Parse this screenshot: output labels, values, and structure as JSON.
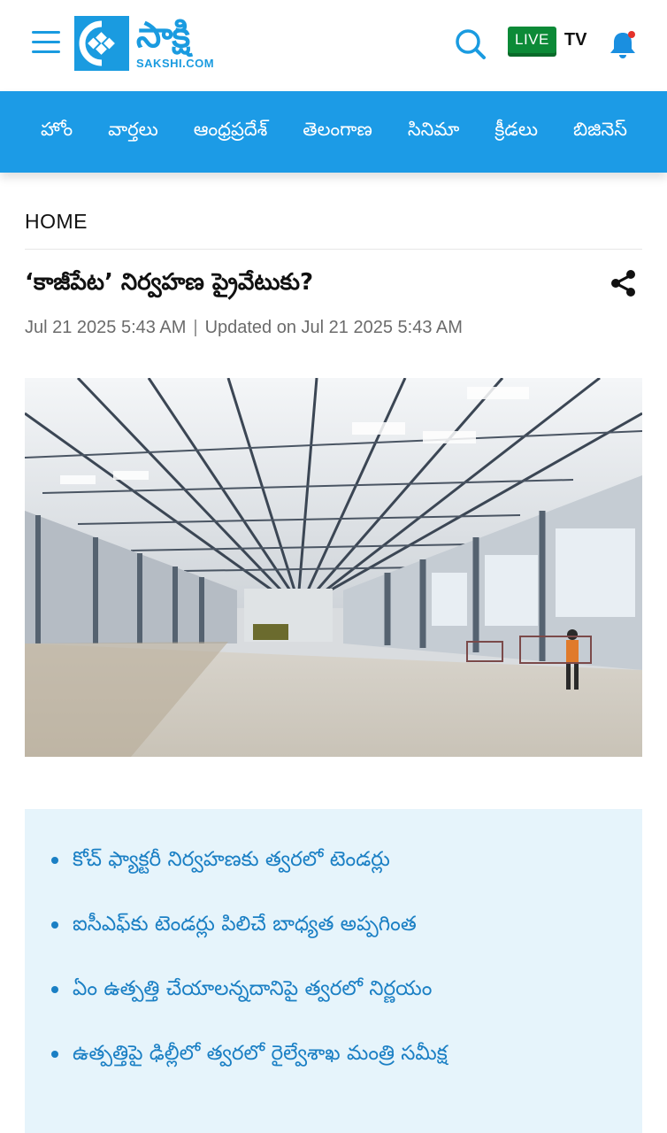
{
  "header": {
    "logo_text": "సాక్షి",
    "logo_url_text": "SAKSHI.COM",
    "live_label": "LIVE",
    "tv_label": "TV",
    "brand_color": "#1a9be0",
    "icons": [
      "menu-icon",
      "search-icon",
      "bell-icon"
    ]
  },
  "nav": {
    "items": [
      {
        "label": "హోం"
      },
      {
        "label": "వార్తలు"
      },
      {
        "label": "ఆంధ్రప్రదేశ్"
      },
      {
        "label": "తెలంగాణ"
      },
      {
        "label": "సినిమా"
      },
      {
        "label": "క్రీడలు"
      },
      {
        "label": "బిజినెస్"
      }
    ],
    "bg_color": "#1c9be6"
  },
  "article": {
    "breadcrumb": "HOME",
    "headline": "‘కాజీపేట’ నిర్వహణ ప్రైవేటుకు?",
    "published": "Jul 21 2025 5:43 AM",
    "separator": "|",
    "updated": "Updated on Jul 21 2025 5:43 AM",
    "image_icon": "factory-photo",
    "highlights": [
      "కోచ్ ఫ్యాక్టరీ నిర్వహణకు త్వరలో టెండర్లు",
      "ఐసీఎఫ్‌కు టెండర్లు పిలిచే బాధ్యత అప్పగింత",
      "ఏం ఉత్పత్తి చేయాలన్నదానిపై త్వరలో నిర్ణయం",
      "ఉత్పత్తిపై ఢిల్లీలో త్వరలో రైల్వేశాఖ మంత్రి సమీక్ష"
    ],
    "highlight_color": "#1a7fc4"
  }
}
